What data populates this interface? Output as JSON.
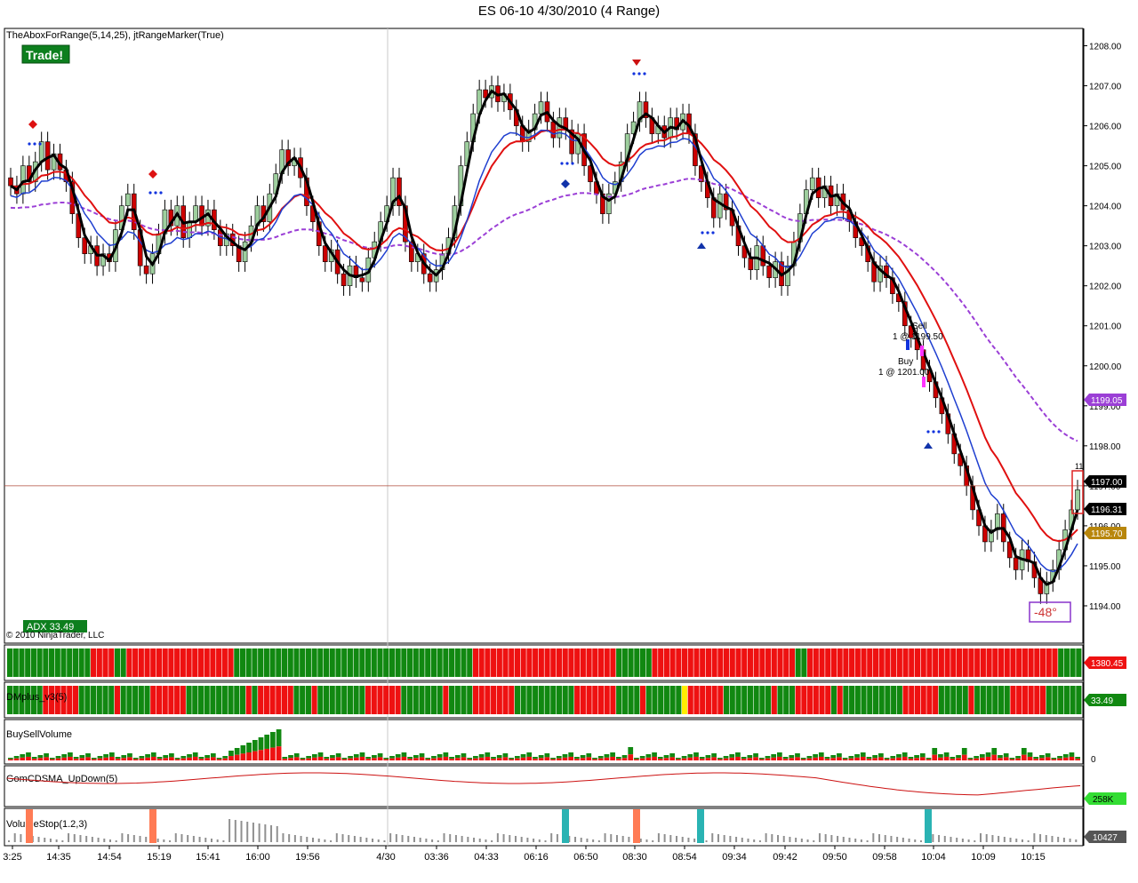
{
  "window": {
    "title": "ES 06-10  4/30/2010 (4 Range)"
  },
  "colors": {
    "up": "#9ecf9e",
    "down": "#cc0000",
    "grid": "#d0d0d0",
    "fast_ma": "#000000",
    "mid_ma": "#1f3fd0",
    "slow_ma": "#e01010",
    "long_ma": "#9b3fd6",
    "gold": "#b8860b",
    "bar_green": "#118811",
    "bar_red": "#ee1111",
    "accent_yellow": "#ffee00",
    "teal": "#2ab3b3",
    "salmon": "#ff7b55"
  },
  "main_panel": {
    "indicator_label": "TheAboxForRange(5,14,25), jtRangeMarker(True)",
    "trade_badge": "Trade!",
    "adx_label": "ADX 33.49",
    "copyright": "© 2010 NinjaTrader, LLC",
    "angle_label": "-48°",
    "trades": [
      {
        "side": "Sell",
        "text": "1 @ 1199.50"
      },
      {
        "side": "Buy",
        "text": "1 @ 1201.00"
      }
    ],
    "price_tags": [
      {
        "value": "1199.05",
        "color": "#9b3fd6"
      },
      {
        "value": "1197.00",
        "color": "#000000"
      },
      {
        "value": "1196.31",
        "color": "#000000"
      },
      {
        "value": "1195.70",
        "color": "#b8860b"
      }
    ],
    "last_price_marker": "11"
  },
  "panels": {
    "p2": {
      "label": "",
      "value_tag": "1380.45"
    },
    "p3": {
      "label": "DMplus_v3(5)",
      "value_tag": "33.49"
    },
    "p4": {
      "label": "BuySellVolume",
      "zero": "0"
    },
    "p5": {
      "label": "GomCDSMA_UpDown(5)",
      "value_tag": "258K"
    },
    "p6": {
      "label": "VolumeStop(1.2,3)",
      "value_tag": "10427"
    }
  },
  "chart_data": {
    "type": "candlestick",
    "title": "ES 06-10  4/30/2010 (4 Range)",
    "y_ticks": [
      "1208.00",
      "1207.00",
      "1206.00",
      "1205.00",
      "1204.00",
      "1203.00",
      "1202.00",
      "1201.00",
      "1200.00",
      "1199.00",
      "1198.00",
      "1197.00",
      "1196.00",
      "1195.00",
      "1194.00"
    ],
    "ylim": [
      1193.2,
      1208.3
    ],
    "x_ticks": [
      "3:25",
      "14:35",
      "14:54",
      "15:19",
      "15:41",
      "16:00",
      "19:56",
      "4/30",
      "03:36",
      "04:33",
      "06:16",
      "06:50",
      "08:30",
      "08:54",
      "09:34",
      "09:42",
      "09:50",
      "09:58",
      "10:04",
      "10:09",
      "10:15"
    ],
    "closes": [
      1204.5,
      1204.3,
      1205.0,
      1204.6,
      1205.1,
      1205.6,
      1204.9,
      1205.3,
      1204.9,
      1204.6,
      1203.8,
      1203.2,
      1202.8,
      1203.0,
      1202.5,
      1202.8,
      1202.6,
      1203.4,
      1204.0,
      1204.3,
      1203.4,
      1202.5,
      1202.3,
      1202.8,
      1203.3,
      1203.9,
      1203.5,
      1204.0,
      1203.2,
      1203.6,
      1204.0,
      1203.5,
      1203.9,
      1203.4,
      1203.0,
      1203.3,
      1203.0,
      1202.6,
      1203.1,
      1203.5,
      1204.0,
      1203.6,
      1204.3,
      1204.8,
      1205.4,
      1205.0,
      1205.2,
      1204.7,
      1204.0,
      1203.6,
      1203.0,
      1202.6,
      1202.9,
      1202.3,
      1202.0,
      1202.5,
      1202.2,
      1202.1,
      1202.7,
      1203.1,
      1203.6,
      1204.0,
      1204.7,
      1204.0,
      1203.1,
      1202.6,
      1202.8,
      1202.3,
      1202.1,
      1202.4,
      1202.8,
      1203.2,
      1204.0,
      1205.0,
      1205.6,
      1206.3,
      1206.9,
      1206.7,
      1207.0,
      1206.6,
      1206.8,
      1206.4,
      1206.0,
      1205.6,
      1205.9,
      1206.3,
      1206.6,
      1206.1,
      1205.7,
      1206.2,
      1205.9,
      1205.3,
      1205.8,
      1205.0,
      1204.6,
      1204.3,
      1203.8,
      1204.3,
      1204.6,
      1205.1,
      1205.8,
      1206.1,
      1206.6,
      1206.2,
      1205.8,
      1206.0,
      1205.7,
      1206.2,
      1205.9,
      1206.3,
      1205.8,
      1205.0,
      1204.6,
      1204.2,
      1203.7,
      1204.3,
      1203.9,
      1203.5,
      1203.0,
      1202.7,
      1202.4,
      1203.0,
      1202.5,
      1202.2,
      1202.6,
      1202.0,
      1202.5,
      1203.1,
      1203.8,
      1204.4,
      1204.7,
      1204.2,
      1204.5,
      1204.0,
      1204.3,
      1203.9,
      1203.6,
      1203.2,
      1203.0,
      1202.6,
      1202.1,
      1202.5,
      1202.2,
      1201.8,
      1201.6,
      1201.0,
      1200.7,
      1200.4,
      1199.9,
      1199.6,
      1199.2,
      1198.8,
      1198.3,
      1197.8,
      1197.5,
      1197.0,
      1196.4,
      1196.0,
      1195.6,
      1195.9,
      1196.3,
      1195.6,
      1195.2,
      1194.9,
      1195.4,
      1195.1,
      1194.7,
      1194.3,
      1194.6,
      1194.9,
      1195.4,
      1195.9,
      1196.4,
      1196.9
    ]
  }
}
